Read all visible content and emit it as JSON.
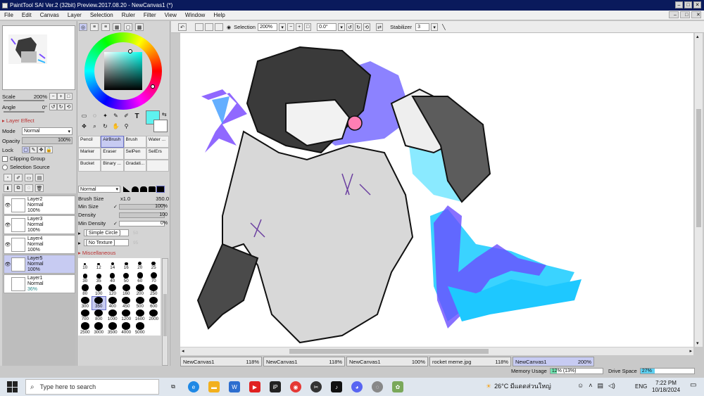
{
  "window": {
    "title": "PaintTool SAI Ver.2 (32bit) Preview.2017.08.20 - NewCanvas1 (*)"
  },
  "menu": [
    "File",
    "Edit",
    "Canvas",
    "Layer",
    "Selection",
    "Ruler",
    "Filter",
    "View",
    "Window",
    "Help"
  ],
  "toolbar": {
    "selection_label": "Selection",
    "zoom": "200%",
    "angle": "0.0°",
    "stabilizer_label": "Stabilizer",
    "stabilizer_value": "3"
  },
  "navigator": {
    "scale_label": "Scale",
    "scale_value": "200%",
    "angle_label": "Angle",
    "angle_value": "0°"
  },
  "layer_effect": {
    "header": "Layer Effect",
    "mode_label": "Mode",
    "mode_value": "Normal",
    "opacity_label": "Opacity",
    "opacity_value": "100%",
    "opacity_fraction": 1.0,
    "lock_label": "Lock",
    "clipping_label": "Clipping Group",
    "selection_source_label": "Selection Source"
  },
  "layers": [
    {
      "name": "Layer2",
      "mode": "Normal",
      "opacity": "100%",
      "selected": false
    },
    {
      "name": "Layer3",
      "mode": "Normal",
      "opacity": "100%",
      "selected": false
    },
    {
      "name": "Layer4",
      "mode": "Normal",
      "opacity": "100%",
      "selected": false
    },
    {
      "name": "Layer5",
      "mode": "Normal",
      "opacity": "100%",
      "selected": true
    },
    {
      "name": "Layer1",
      "mode": "Normal",
      "opacity": "36%",
      "selected": false
    }
  ],
  "tools": [
    {
      "label": "Pencil",
      "selected": false
    },
    {
      "label": "AirBrush",
      "selected": true
    },
    {
      "label": "Brush",
      "selected": false
    },
    {
      "label": "Water ...",
      "selected": false
    },
    {
      "label": "Marker",
      "selected": false
    },
    {
      "label": "Eraser",
      "selected": false
    },
    {
      "label": "SelPen",
      "selected": false
    },
    {
      "label": "SelErs",
      "selected": false
    },
    {
      "label": "Bucket",
      "selected": false
    },
    {
      "label": "Binary ...",
      "selected": false
    },
    {
      "label": "Gradati...",
      "selected": false
    },
    {
      "label": "",
      "selected": false
    }
  ],
  "brush": {
    "blend_mode": "Normal",
    "size_label": "Brush Size",
    "size_mult": "x1.0",
    "size_value": "350.0",
    "min_size_label": "Min Size",
    "min_size_value": "100%",
    "min_size_fraction": 1.0,
    "density_label": "Density",
    "density_value": "100",
    "density_fraction": 1.0,
    "min_density_label": "Min Density",
    "min_density_value": "0%",
    "min_density_fraction": 0.0,
    "shape": "[ Simple Circle ]",
    "texture": "[ No Texture ]",
    "shape_strength": "50",
    "texture_strength": "95",
    "misc_label": "Miscellaneous"
  },
  "brush_sizes": [
    "10",
    "12",
    "14",
    "16",
    "20",
    "25",
    "30",
    "35",
    "40",
    "50",
    "60",
    "70",
    "80",
    "100",
    "120",
    "160",
    "200",
    "250",
    "300",
    "350",
    "400",
    "450",
    "500",
    "600",
    "700",
    "800",
    "1000",
    "1200",
    "1600",
    "2000",
    "2500",
    "3000",
    "3500",
    "4000",
    "5000"
  ],
  "selected_brush_size": "350",
  "colors": {
    "primary": "#5ef2ef",
    "accent": "#6b72c8",
    "title_bar": "#0a1a5c"
  },
  "doc_tabs": [
    {
      "name": "NewCanvas1",
      "zoom": "118%",
      "active": false
    },
    {
      "name": "NewCanvas1",
      "zoom": "118%",
      "active": false
    },
    {
      "name": "NewCanvas1",
      "zoom": "100%",
      "active": false
    },
    {
      "name": "rocket meme.jpg",
      "zoom": "118%",
      "active": false
    },
    {
      "name": "NewCanvas1",
      "zoom": "200%",
      "active": true
    }
  ],
  "status": {
    "memory_label": "Memory Usage",
    "memory_value": "12% (13%)",
    "memory_fraction": 0.12,
    "drive_label": "Drive Space",
    "drive_value": "27%",
    "drive_fraction": 0.27
  },
  "taskbar": {
    "search_placeholder": "Type here to search",
    "weather": "26°C มีแดดส่วนใหญ่",
    "lang": "ENG",
    "time": "7:22 PM",
    "date": "10/18/2024"
  }
}
